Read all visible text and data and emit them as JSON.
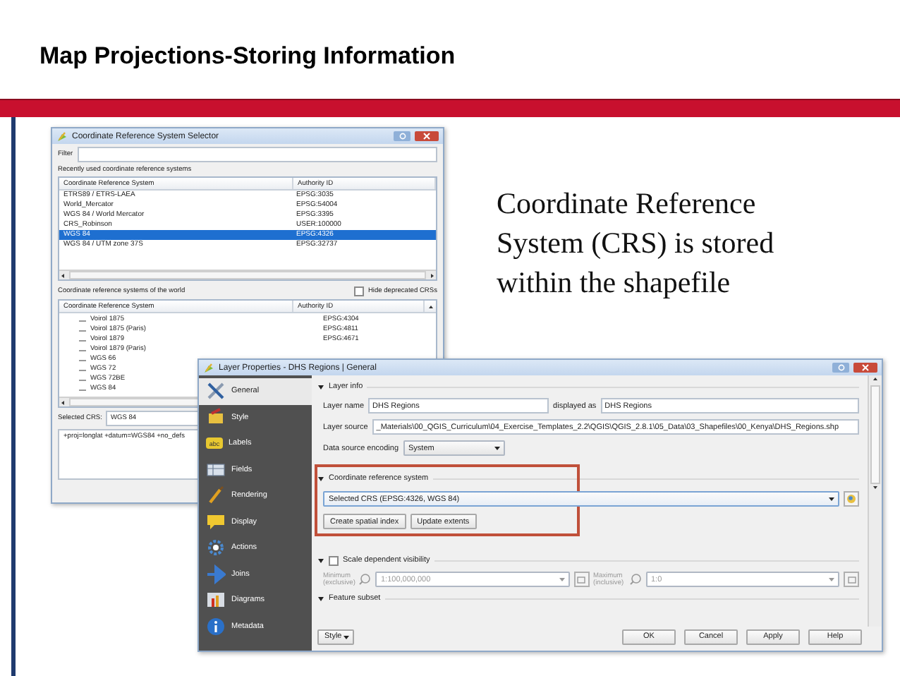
{
  "slide": {
    "title": "Map Projections-Storing Information",
    "note": "Coordinate Reference System (CRS) is stored within the shapefile"
  },
  "crs_selector": {
    "title": "Coordinate Reference System Selector",
    "filter_label": "Filter",
    "recent_label": "Recently used coordinate reference systems",
    "recent_columns": [
      "Coordinate Reference System",
      "Authority ID"
    ],
    "recent_rows": [
      {
        "name": "ETRS89 / ETRS-LAEA",
        "authority": "EPSG:3035",
        "selected": false
      },
      {
        "name": "World_Mercator",
        "authority": "EPSG:54004",
        "selected": false
      },
      {
        "name": "WGS 84 / World Mercator",
        "authority": "EPSG:3395",
        "selected": false
      },
      {
        "name": "CRS_Robinson",
        "authority": "USER:100000",
        "selected": false
      },
      {
        "name": "WGS 84",
        "authority": "EPSG:4326",
        "selected": true
      },
      {
        "name": "WGS 84 / UTM zone 37S",
        "authority": "EPSG:32737",
        "selected": false
      }
    ],
    "world_label": "Coordinate reference systems of the world",
    "hide_deprecated": {
      "label": "Hide deprecated CRSs",
      "checked": false
    },
    "world_columns": [
      "Coordinate Reference System",
      "Authority ID"
    ],
    "world_rows": [
      {
        "name": "Voirol 1875",
        "authority": "EPSG:4304"
      },
      {
        "name": "Voirol 1875 (Paris)",
        "authority": "EPSG:4811"
      },
      {
        "name": "Voirol 1879",
        "authority": "EPSG:4671"
      },
      {
        "name": "Voirol 1879 (Paris)"
      },
      {
        "name": "WGS 66"
      },
      {
        "name": "WGS 72"
      },
      {
        "name": "WGS 72BE"
      },
      {
        "name": "WGS 84"
      }
    ],
    "selected_label": "Selected CRS:",
    "selected_value": "WGS 84",
    "proj_string": "+proj=longlat +datum=WGS84 +no_defs"
  },
  "layer_properties": {
    "title": "Layer Properties - DHS Regions | General",
    "sidebar": [
      {
        "label": "General",
        "selected": true
      },
      {
        "label": "Style",
        "selected": false
      },
      {
        "label": "Labels",
        "selected": false,
        "badge": "abc"
      },
      {
        "label": "Fields",
        "selected": false
      },
      {
        "label": "Rendering",
        "selected": false
      },
      {
        "label": "Display",
        "selected": false
      },
      {
        "label": "Actions",
        "selected": false
      },
      {
        "label": "Joins",
        "selected": false
      },
      {
        "label": "Diagrams",
        "selected": false
      },
      {
        "label": "Metadata",
        "selected": false
      }
    ],
    "layer_info": {
      "heading": "Layer info",
      "expanded": true,
      "name_label": "Layer name",
      "name": "DHS Regions",
      "displayed_label": "displayed as",
      "displayed": "DHS Regions",
      "source_label": "Layer source",
      "source": "_Materials\\00_QGIS_Curriculum\\04_Exercise_Templates_2.2\\QGIS\\QGIS_2.8.1\\05_Data\\03_Shapefiles\\00_Kenya\\DHS_Regions.shp",
      "encoding_label": "Data source encoding",
      "encoding": "System"
    },
    "crs_group": {
      "heading": "Coordinate reference system",
      "expanded": true,
      "highlighted": true,
      "selected_crs": "Selected CRS (EPSG:4326, WGS 84)",
      "buttons": [
        "Create spatial index",
        "Update extents"
      ]
    },
    "scale_group": {
      "heading": "Scale dependent visibility",
      "expanded": true,
      "checked": false,
      "min_label": "Minimum (exclusive)",
      "min_value": "1:100,000,000",
      "max_label": "Maximum (inclusive)",
      "max_value": "1:0"
    },
    "feature_subset": {
      "heading": "Feature subset",
      "expanded": true
    },
    "style_button": "Style",
    "buttons": [
      "OK",
      "Cancel",
      "Apply",
      "Help"
    ]
  }
}
